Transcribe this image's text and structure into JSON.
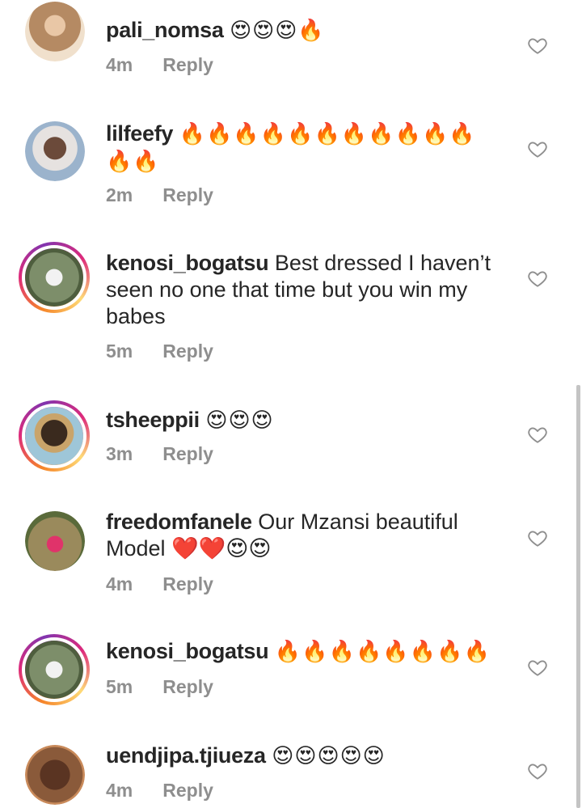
{
  "comments": [
    {
      "username": "pali_nomsa",
      "text": "😍😍😍🔥",
      "time": "4m",
      "reply": "Reply",
      "avatar_color": "#b58a63",
      "story_ring": false
    },
    {
      "username": "lilfeefy",
      "text": "🔥🔥🔥🔥🔥🔥🔥🔥🔥🔥🔥🔥🔥",
      "time": "2m",
      "reply": "Reply",
      "avatar_color": "#8fa8c4",
      "story_ring": false
    },
    {
      "username": "kenosi_bogatsu",
      "text": "Best dressed I haven’t seen no one that time but you win my babes",
      "time": "5m",
      "reply": "Reply",
      "avatar_color": "#7d8e6a",
      "story_ring": true
    },
    {
      "username": "tsheeppii",
      "text": "😍😍😍",
      "time": "3m",
      "reply": "Reply",
      "avatar_color": "#6a5a4a",
      "story_ring": true
    },
    {
      "username": "freedomfanele",
      "text": "Our Mzansi beautiful Model ❤️❤️😍😍",
      "time": "4m",
      "reply": "Reply",
      "avatar_color": "#9a8a5c",
      "story_ring": false
    },
    {
      "username": "kenosi_bogatsu",
      "text": "🔥🔥🔥🔥🔥🔥🔥🔥",
      "time": "5m",
      "reply": "Reply",
      "avatar_color": "#7d8e6a",
      "story_ring": true
    },
    {
      "username": "uendjipa.tjiueza",
      "text": "😍😍😍😍😍",
      "time": "4m",
      "reply": "Reply",
      "avatar_color": "#8a5a3a",
      "story_ring": false
    }
  ],
  "icons": {
    "like": "heart-outline-icon"
  },
  "colors": {
    "text": "#262626",
    "secondary": "#8e8e8e"
  }
}
